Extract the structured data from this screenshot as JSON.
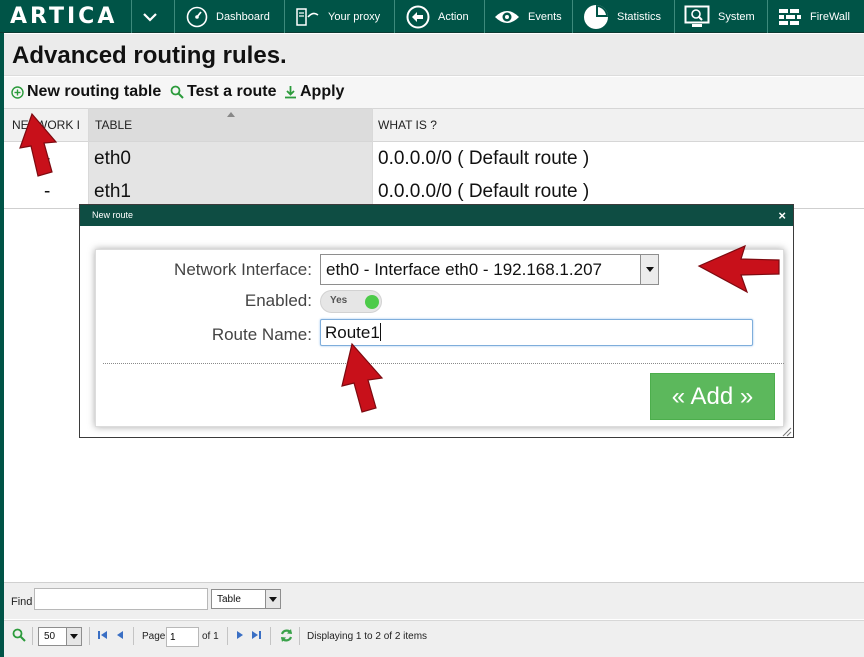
{
  "app": {
    "brand": "ARTICA"
  },
  "nav": {
    "items": [
      {
        "label": "Dashboard",
        "icon": "speedometer-icon"
      },
      {
        "label": "Your proxy",
        "icon": "proxy-server-icon"
      },
      {
        "label": "Action",
        "icon": "back-arrow-circle-icon"
      },
      {
        "label": "Events",
        "icon": "eye-icon"
      },
      {
        "label": "Statistics",
        "icon": "pie-chart-icon"
      },
      {
        "label": "System",
        "icon": "computer-monitor-icon"
      },
      {
        "label": "FireWall",
        "icon": "firewall-bricks-icon"
      }
    ]
  },
  "page": {
    "title": "Advanced routing rules."
  },
  "toolbar": {
    "new_table": "New routing table",
    "test_route": "Test a route",
    "apply": "Apply"
  },
  "grid": {
    "columns": [
      "NETWORK I",
      "TABLE",
      "WHAT IS ?"
    ],
    "rows": [
      {
        "network": "-",
        "table": "eth0",
        "what": "0.0.0.0/0 ( Default route )"
      },
      {
        "network": "-",
        "table": "eth1",
        "what": "0.0.0.0/0 ( Default route )"
      }
    ]
  },
  "footer": {
    "find_label": "Find",
    "find_value": "",
    "find_field": "Table",
    "page_size": "50",
    "page_label": "Page",
    "page_value": "1",
    "page_of": "of 1",
    "displaying": "Displaying 1 to 2 of 2 items"
  },
  "modal": {
    "title": "New route",
    "close": "×",
    "iface_label": "Network Interface:",
    "iface_value": "eth0 - Interface eth0 - 192.168.1.207",
    "enabled_label": "Enabled:",
    "enabled_value": "Yes",
    "route_label": "Route Name:",
    "route_value": "Route1",
    "add_button": "« Add »"
  },
  "colors": {
    "nav_bg": "#005447",
    "modal_header": "#0e4d43",
    "add_button": "#5cb85c",
    "toggle_on": "#4dcb4a",
    "annotation_arrow": "#c8101a"
  }
}
